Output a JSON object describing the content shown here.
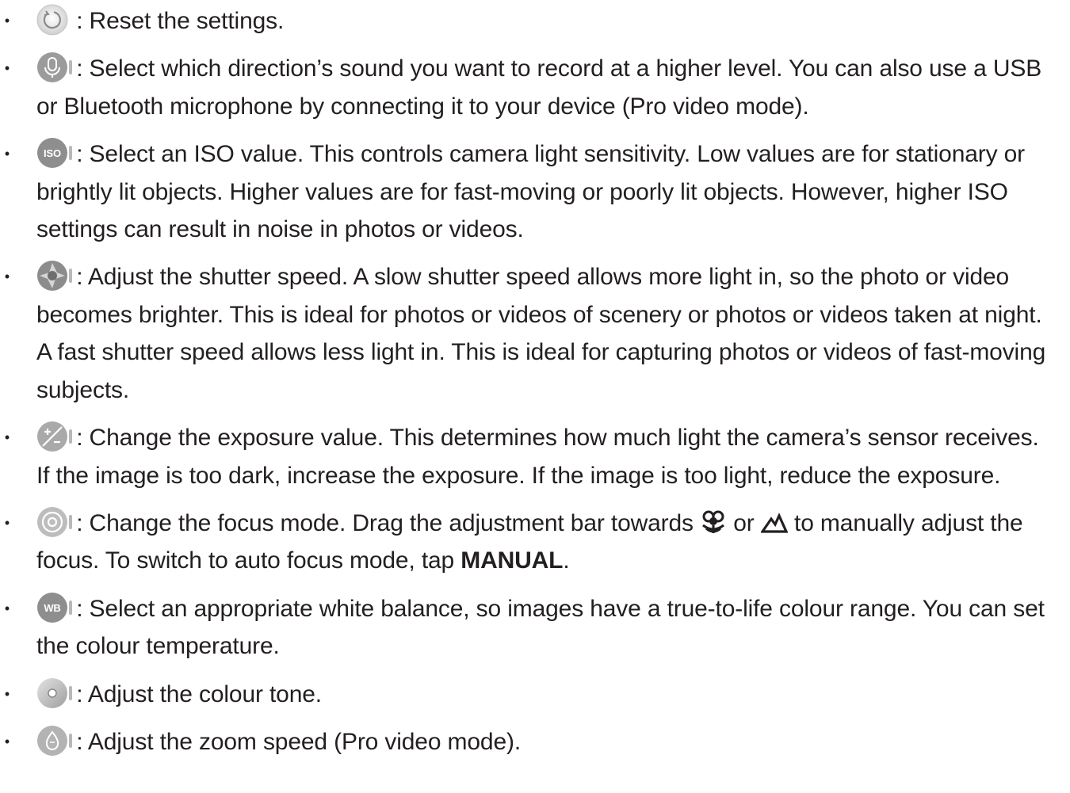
{
  "items": [
    {
      "icon": "reset-icon",
      "text": ": Reset the settings."
    },
    {
      "icon": "microphone-icon",
      "text": ": Select which direction’s sound you want to record at a higher level. You can also use a USB or Bluetooth microphone by connecting it to your device (Pro video mode)."
    },
    {
      "icon": "iso-icon",
      "icon_label": "ISO",
      "text": ": Select an ISO value. This controls camera light sensitivity. Low values are for stationary or brightly lit objects. Higher values are for fast-moving or poorly lit objects. However, higher ISO settings can result in noise in photos or videos."
    },
    {
      "icon": "shutter-speed-icon",
      "text": ": Adjust the shutter speed. A slow shutter speed allows more light in, so the photo or video becomes brighter. This is ideal for photos or videos of scenery or photos or videos taken at night. A fast shutter speed allows less light in. This is ideal for capturing photos or videos of fast-moving subjects."
    },
    {
      "icon": "exposure-icon",
      "text": ": Change the exposure value. This determines how much light the camera’s sensor receives. If the image is too dark, increase the exposure. If the image is too light, reduce the exposure."
    },
    {
      "icon": "focus-icon",
      "text_a": ": Change the focus mode. Drag the adjustment bar towards ",
      "glyph_1": "macro-flower-icon",
      "text_b": " or ",
      "glyph_2": "mountain-icon",
      "text_c": " to manually adjust the focus. To switch to auto focus mode, tap ",
      "bold": "MANUAL",
      "text_d": "."
    },
    {
      "icon": "white-balance-icon",
      "icon_label": "WB",
      "text": ": Select an appropriate white balance, so images have a true-to-life colour range. You can set the colour temperature."
    },
    {
      "icon": "colour-tone-icon",
      "text": ": Adjust the colour tone."
    },
    {
      "icon": "zoom-speed-icon",
      "text": ": Adjust the zoom speed (Pro video mode)."
    }
  ],
  "bullet": "•"
}
